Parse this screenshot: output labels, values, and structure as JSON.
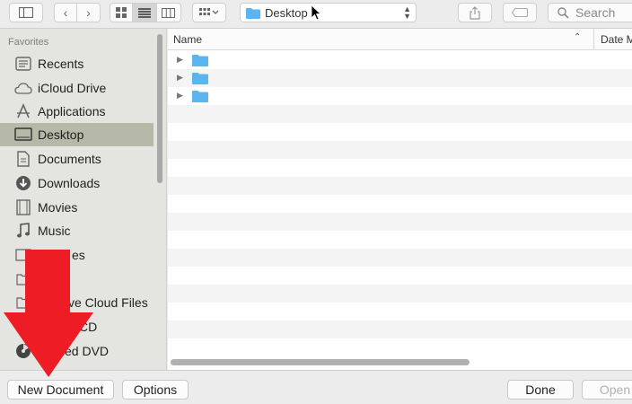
{
  "toolbar": {
    "location": "Desktop",
    "search_placeholder": "Search"
  },
  "sidebar": {
    "heading": "Favorites",
    "items": [
      {
        "label": "Recents",
        "icon": "clock-icon"
      },
      {
        "label": "iCloud Drive",
        "icon": "cloud-icon"
      },
      {
        "label": "Applications",
        "icon": "applications-icon"
      },
      {
        "label": "Desktop",
        "icon": "desktop-icon",
        "selected": true
      },
      {
        "label": "Documents",
        "icon": "document-icon"
      },
      {
        "label": "Downloads",
        "icon": "download-icon"
      },
      {
        "label": "Movies",
        "icon": "film-icon"
      },
      {
        "label": "Music",
        "icon": "music-note-icon"
      },
      {
        "label": "es",
        "icon": "pictures-icon"
      },
      {
        "label": "",
        "icon": "folder-icon"
      },
      {
        "label": "ve Cloud Files",
        "icon": "folder-icon"
      },
      {
        "label": "CD",
        "icon": "disc-icon"
      },
      {
        "label": "ed DVD",
        "icon": "disc-icon"
      }
    ]
  },
  "file_list": {
    "columns": {
      "name": "Name",
      "date": "Date M"
    },
    "rows": [
      "",
      "",
      ""
    ]
  },
  "buttons": {
    "new_document": "New Document",
    "options": "Options",
    "done": "Done",
    "open": "Open"
  },
  "colors": {
    "selection": "#b6b8a8",
    "folder_blue": "#5bb4ee",
    "annotation_arrow": "#ee1c24"
  }
}
